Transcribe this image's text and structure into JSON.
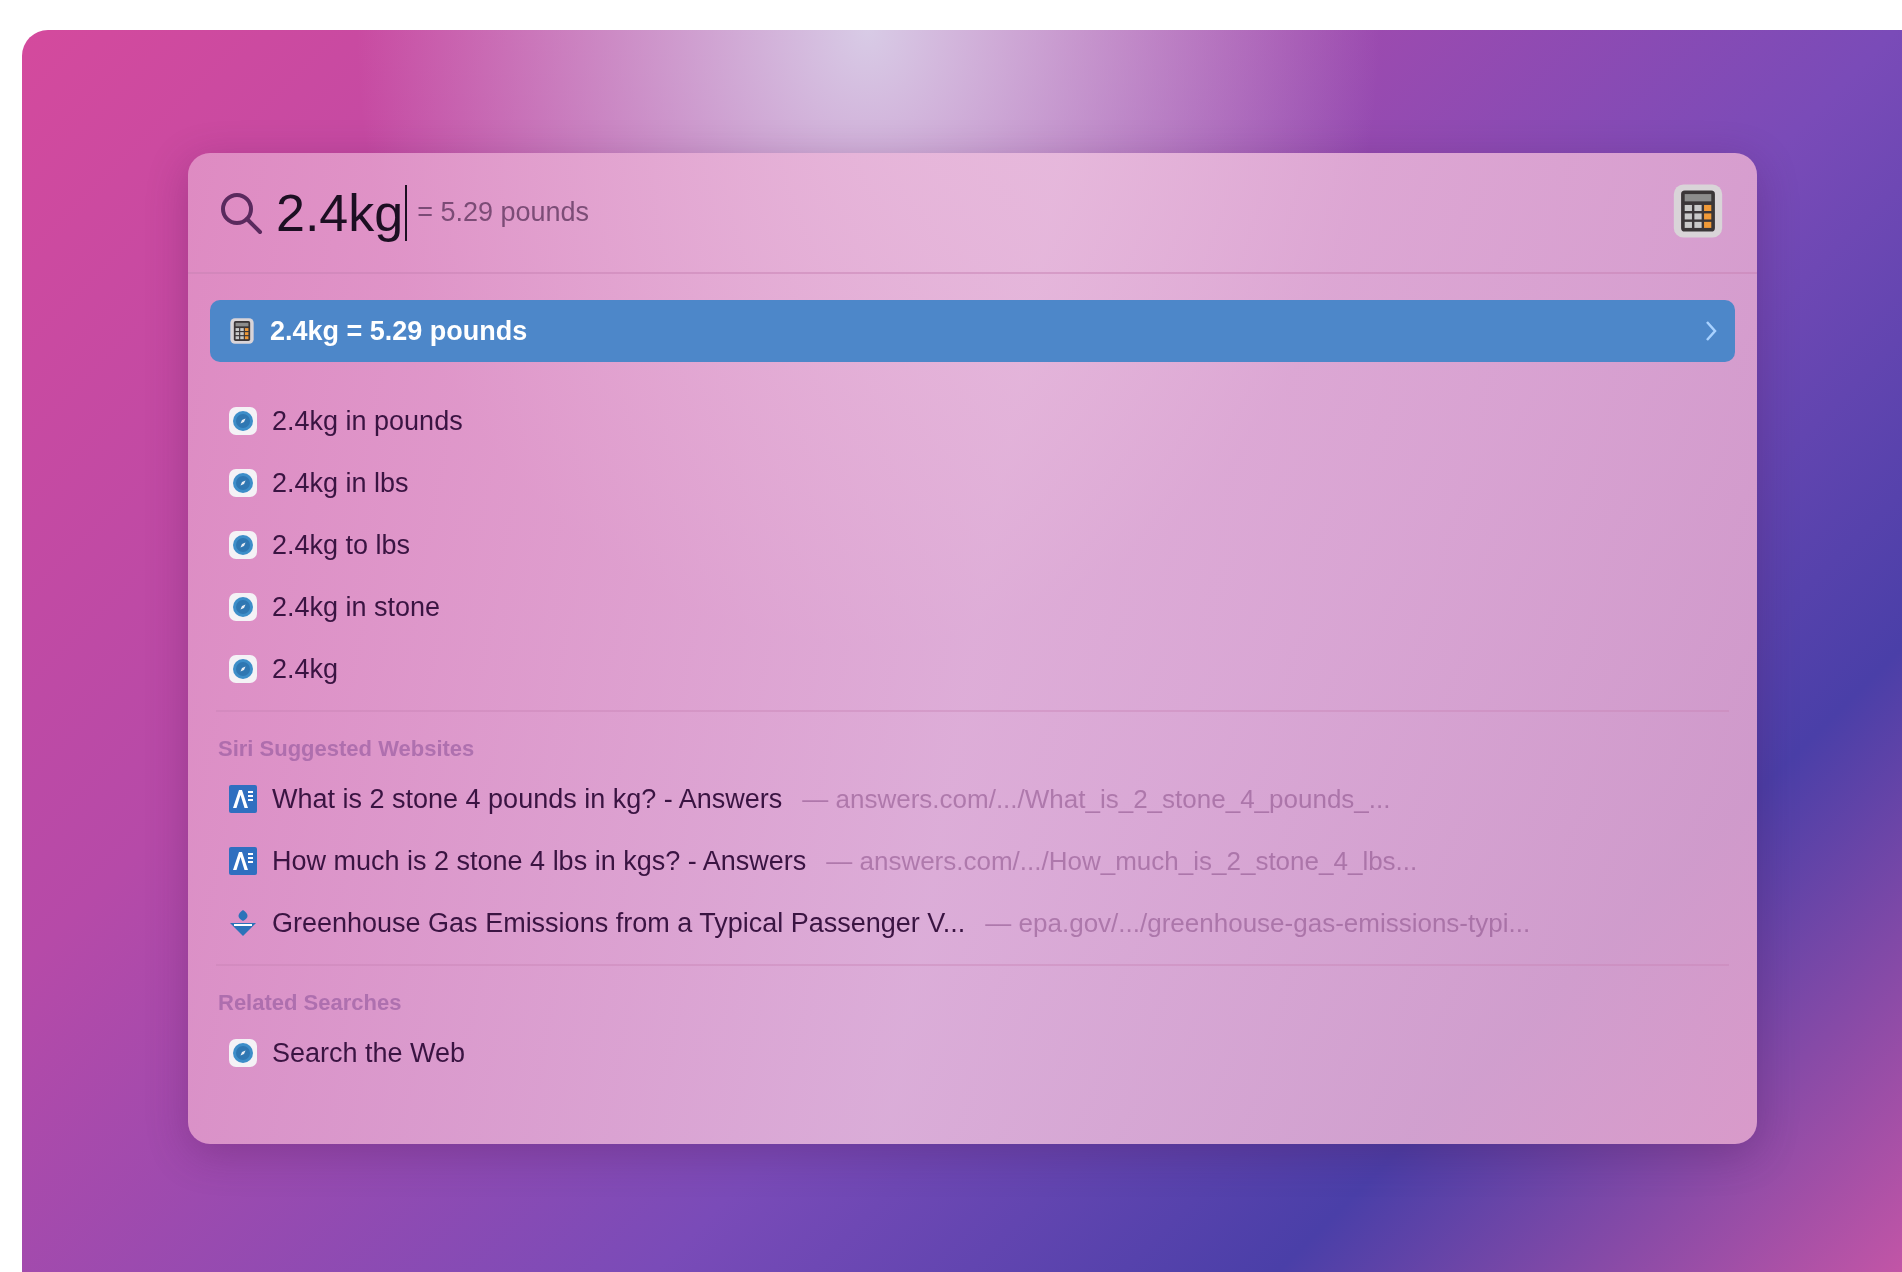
{
  "search": {
    "value": "2.4kg",
    "hint": "= 5.29 pounds"
  },
  "top_hit": {
    "text": "2.4kg = 5.29 pounds",
    "selected": true
  },
  "suggestions": [
    {
      "text": "2.4kg in pounds",
      "selected": false
    },
    {
      "text": "2.4kg in lbs",
      "selected": false
    },
    {
      "text": "2.4kg to lbs",
      "selected": false
    },
    {
      "text": "2.4kg in stone",
      "selected": false
    },
    {
      "text": "2.4kg",
      "selected": false
    }
  ],
  "sections": [
    {
      "title": "Siri Suggested Websites",
      "items": [
        {
          "kind": "answers",
          "title": "What is 2 stone 4 pounds in kg? - Answers",
          "url": "— answers.com/.../What_is_2_stone_4_pounds_...",
          "selected": false
        },
        {
          "kind": "answers",
          "title": "How much is 2 stone 4 lbs in kgs? - Answers",
          "url": "— answers.com/.../How_much_is_2_stone_4_lbs...",
          "selected": false
        },
        {
          "kind": "epa",
          "title": "Greenhouse Gas Emissions from a Typical Passenger V...",
          "url": "— epa.gov/.../greenhouse-gas-emissions-typi...",
          "selected": false
        }
      ]
    },
    {
      "title": "Related Searches",
      "items": [
        {
          "kind": "web",
          "title": "Search the Web",
          "selected": false
        }
      ]
    }
  ]
}
